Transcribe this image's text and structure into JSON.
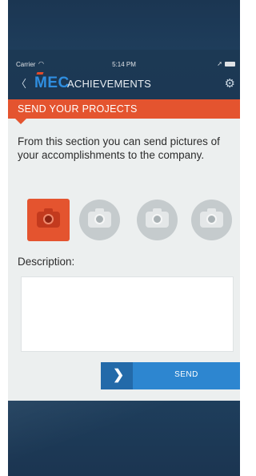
{
  "status_bar": {
    "carrier": "Carrier",
    "time": "5:14 PM"
  },
  "nav": {
    "logo": "MEC",
    "title": "ACHIEVEMENTS"
  },
  "section": {
    "title": "SEND YOUR PROJECTS",
    "intro": "From this section you can send pictures of your accomplishments to the company."
  },
  "photos": [
    {
      "state": "active"
    },
    {
      "state": "inactive"
    },
    {
      "state": "inactive"
    },
    {
      "state": "inactive"
    }
  ],
  "description": {
    "label": "Description:",
    "value": ""
  },
  "send_button": {
    "label": "SEND"
  },
  "colors": {
    "accent_orange": "#e4542f",
    "button_blue": "#2d86d0",
    "navy": "#1d3a55"
  },
  "icons": [
    "back-icon",
    "gear-icon",
    "camera-icon",
    "chevron-right-icon",
    "wifi-icon",
    "battery-icon"
  ]
}
